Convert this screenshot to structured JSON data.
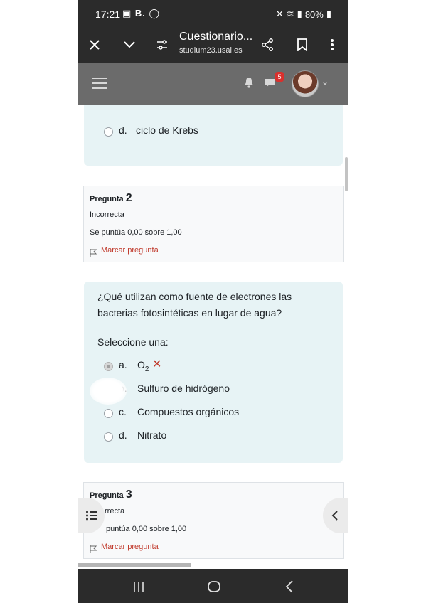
{
  "status_bar": {
    "time": "17:21",
    "left_icons": "B.",
    "battery": "80%"
  },
  "browser": {
    "title": "Cuestionario...",
    "url": "studium23.usal.es",
    "icons": [
      "close-icon",
      "chevron-down-icon",
      "site-settings-icon",
      "share-icon",
      "bookmark-icon",
      "more-icon"
    ]
  },
  "navbar": {
    "notification_badge": "5"
  },
  "prev_question": {
    "option_d_letter": "d.",
    "option_d_text": "ciclo de Krebs"
  },
  "question2": {
    "header_label": "Pregunta",
    "number": "2",
    "status": "Incorrecta",
    "score": "Se puntúa 0,00 sobre 1,00",
    "flag_label": "Marcar pregunta",
    "text_line1": "¿Qué utilizan como fuente de electrones las",
    "text_line2": "bacterias fotosintéticas en lugar de agua?",
    "prompt": "Seleccione una:",
    "options": [
      {
        "letter": "a.",
        "text": "O",
        "sub": "2",
        "mark": "✕"
      },
      {
        "letter": "b.",
        "text": "Sulfuro de hidrógeno"
      },
      {
        "letter": "c.",
        "text": "Compuestos orgánicos"
      },
      {
        "letter": "d.",
        "text": "Nitrato"
      }
    ]
  },
  "question3": {
    "header_label": "Pregunta",
    "number": "3",
    "status": "rrecta",
    "score": "puntúa 0,00 sobre 1,00",
    "flag_label": "Marcar pregunta"
  },
  "colors": {
    "accent_red": "#c0392b",
    "card_blue": "#e7f3f5",
    "dark_bar": "#2b2b2b"
  }
}
